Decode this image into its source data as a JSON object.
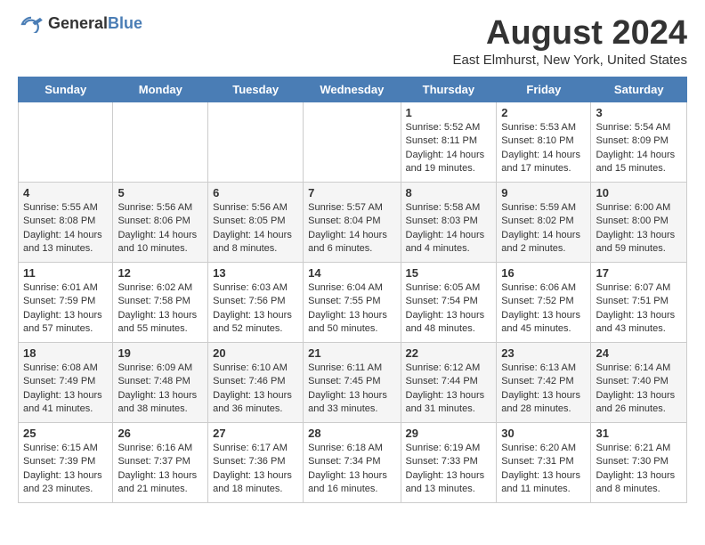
{
  "header": {
    "logo_general": "General",
    "logo_blue": "Blue",
    "month_title": "August 2024",
    "location": "East Elmhurst, New York, United States"
  },
  "calendar": {
    "days_of_week": [
      "Sunday",
      "Monday",
      "Tuesday",
      "Wednesday",
      "Thursday",
      "Friday",
      "Saturday"
    ],
    "weeks": [
      [
        {
          "day": "",
          "info": ""
        },
        {
          "day": "",
          "info": ""
        },
        {
          "day": "",
          "info": ""
        },
        {
          "day": "",
          "info": ""
        },
        {
          "day": "1",
          "info": "Sunrise: 5:52 AM\nSunset: 8:11 PM\nDaylight: 14 hours\nand 19 minutes."
        },
        {
          "day": "2",
          "info": "Sunrise: 5:53 AM\nSunset: 8:10 PM\nDaylight: 14 hours\nand 17 minutes."
        },
        {
          "day": "3",
          "info": "Sunrise: 5:54 AM\nSunset: 8:09 PM\nDaylight: 14 hours\nand 15 minutes."
        }
      ],
      [
        {
          "day": "4",
          "info": "Sunrise: 5:55 AM\nSunset: 8:08 PM\nDaylight: 14 hours\nand 13 minutes."
        },
        {
          "day": "5",
          "info": "Sunrise: 5:56 AM\nSunset: 8:06 PM\nDaylight: 14 hours\nand 10 minutes."
        },
        {
          "day": "6",
          "info": "Sunrise: 5:56 AM\nSunset: 8:05 PM\nDaylight: 14 hours\nand 8 minutes."
        },
        {
          "day": "7",
          "info": "Sunrise: 5:57 AM\nSunset: 8:04 PM\nDaylight: 14 hours\nand 6 minutes."
        },
        {
          "day": "8",
          "info": "Sunrise: 5:58 AM\nSunset: 8:03 PM\nDaylight: 14 hours\nand 4 minutes."
        },
        {
          "day": "9",
          "info": "Sunrise: 5:59 AM\nSunset: 8:02 PM\nDaylight: 14 hours\nand 2 minutes."
        },
        {
          "day": "10",
          "info": "Sunrise: 6:00 AM\nSunset: 8:00 PM\nDaylight: 13 hours\nand 59 minutes."
        }
      ],
      [
        {
          "day": "11",
          "info": "Sunrise: 6:01 AM\nSunset: 7:59 PM\nDaylight: 13 hours\nand 57 minutes."
        },
        {
          "day": "12",
          "info": "Sunrise: 6:02 AM\nSunset: 7:58 PM\nDaylight: 13 hours\nand 55 minutes."
        },
        {
          "day": "13",
          "info": "Sunrise: 6:03 AM\nSunset: 7:56 PM\nDaylight: 13 hours\nand 52 minutes."
        },
        {
          "day": "14",
          "info": "Sunrise: 6:04 AM\nSunset: 7:55 PM\nDaylight: 13 hours\nand 50 minutes."
        },
        {
          "day": "15",
          "info": "Sunrise: 6:05 AM\nSunset: 7:54 PM\nDaylight: 13 hours\nand 48 minutes."
        },
        {
          "day": "16",
          "info": "Sunrise: 6:06 AM\nSunset: 7:52 PM\nDaylight: 13 hours\nand 45 minutes."
        },
        {
          "day": "17",
          "info": "Sunrise: 6:07 AM\nSunset: 7:51 PM\nDaylight: 13 hours\nand 43 minutes."
        }
      ],
      [
        {
          "day": "18",
          "info": "Sunrise: 6:08 AM\nSunset: 7:49 PM\nDaylight: 13 hours\nand 41 minutes."
        },
        {
          "day": "19",
          "info": "Sunrise: 6:09 AM\nSunset: 7:48 PM\nDaylight: 13 hours\nand 38 minutes."
        },
        {
          "day": "20",
          "info": "Sunrise: 6:10 AM\nSunset: 7:46 PM\nDaylight: 13 hours\nand 36 minutes."
        },
        {
          "day": "21",
          "info": "Sunrise: 6:11 AM\nSunset: 7:45 PM\nDaylight: 13 hours\nand 33 minutes."
        },
        {
          "day": "22",
          "info": "Sunrise: 6:12 AM\nSunset: 7:44 PM\nDaylight: 13 hours\nand 31 minutes."
        },
        {
          "day": "23",
          "info": "Sunrise: 6:13 AM\nSunset: 7:42 PM\nDaylight: 13 hours\nand 28 minutes."
        },
        {
          "day": "24",
          "info": "Sunrise: 6:14 AM\nSunset: 7:40 PM\nDaylight: 13 hours\nand 26 minutes."
        }
      ],
      [
        {
          "day": "25",
          "info": "Sunrise: 6:15 AM\nSunset: 7:39 PM\nDaylight: 13 hours\nand 23 minutes."
        },
        {
          "day": "26",
          "info": "Sunrise: 6:16 AM\nSunset: 7:37 PM\nDaylight: 13 hours\nand 21 minutes."
        },
        {
          "day": "27",
          "info": "Sunrise: 6:17 AM\nSunset: 7:36 PM\nDaylight: 13 hours\nand 18 minutes."
        },
        {
          "day": "28",
          "info": "Sunrise: 6:18 AM\nSunset: 7:34 PM\nDaylight: 13 hours\nand 16 minutes."
        },
        {
          "day": "29",
          "info": "Sunrise: 6:19 AM\nSunset: 7:33 PM\nDaylight: 13 hours\nand 13 minutes."
        },
        {
          "day": "30",
          "info": "Sunrise: 6:20 AM\nSunset: 7:31 PM\nDaylight: 13 hours\nand 11 minutes."
        },
        {
          "day": "31",
          "info": "Sunrise: 6:21 AM\nSunset: 7:30 PM\nDaylight: 13 hours\nand 8 minutes."
        }
      ]
    ]
  }
}
